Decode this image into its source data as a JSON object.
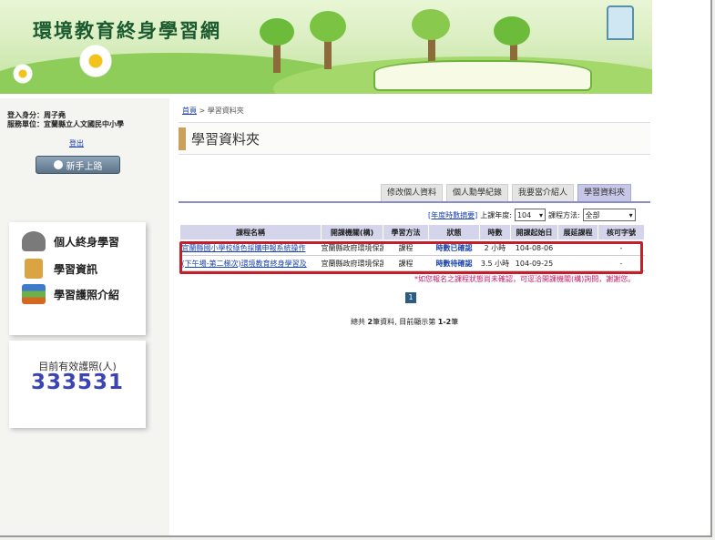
{
  "site": {
    "title": "環境教育終身學習網"
  },
  "user": {
    "identity_label": "登入身分：",
    "identity_value": "周子堯",
    "unit_label": "服務單位：",
    "unit_value": "宜蘭縣立人文國民中小學",
    "logout": "登出",
    "newbie_button": "新手上路"
  },
  "sidebar": {
    "menu": [
      {
        "label": "個人終身學習",
        "icon": "graduate-icon",
        "color": "#7a7a7a"
      },
      {
        "label": "學習資訊",
        "icon": "clipboard-icon",
        "color": "#d9a441"
      },
      {
        "label": "學習護照介紹",
        "icon": "books-icon",
        "color": "#c87a2e"
      }
    ],
    "counter_label": "目前有效護照(人)",
    "counter_value": "333531"
  },
  "breadcrumb": {
    "home": "首頁",
    "separator": " > ",
    "current": "學習資料夾"
  },
  "page_title": "學習資料夾",
  "tabs": [
    "修改個人資料",
    "個人勳學紀錄",
    "我要當介紹人",
    "學習資料夾"
  ],
  "filters": {
    "annual_link": "[年度時數摘要]",
    "year_label": "上課年度:",
    "year_value": "104",
    "method_label": "課程方法:",
    "method_value": "全部"
  },
  "table": {
    "headers": [
      "課程名稱",
      "開課機關(構)",
      "學習方法",
      "狀態",
      "時數",
      "開課起始日",
      "展延課程",
      "核可字號"
    ],
    "rows": [
      {
        "name": "宜蘭縣國小學校綠色採購申報系統操作",
        "org": "宜蘭縣政府環境保護局",
        "method": "課程",
        "status": "時數已確認",
        "hours": "2 小時",
        "start": "104-08-06",
        "extend": "",
        "approval": "-"
      },
      {
        "name": "(下午場-第二梯次)環境教育終身學習及",
        "org": "宜蘭縣政府環境保護局",
        "method": "課程",
        "status": "時數待確認",
        "hours": "3.5 小時",
        "start": "104-09-25",
        "extend": "",
        "approval": "-"
      }
    ]
  },
  "notice": "*如您報名之課程狀態尚未確認，可逕洽開課機關(構)詢問，謝謝您。",
  "pagination": {
    "current": "1"
  },
  "summary": {
    "prefix": "總共 ",
    "count": "2",
    "middle": "筆資料, 目前顯示第 ",
    "range": "1-2",
    "suffix": "筆"
  },
  "colors": {
    "accent": "#8b8bcc",
    "link": "#1b44b0",
    "highlight": "#c41e2b",
    "counter": "#3a44b4"
  }
}
